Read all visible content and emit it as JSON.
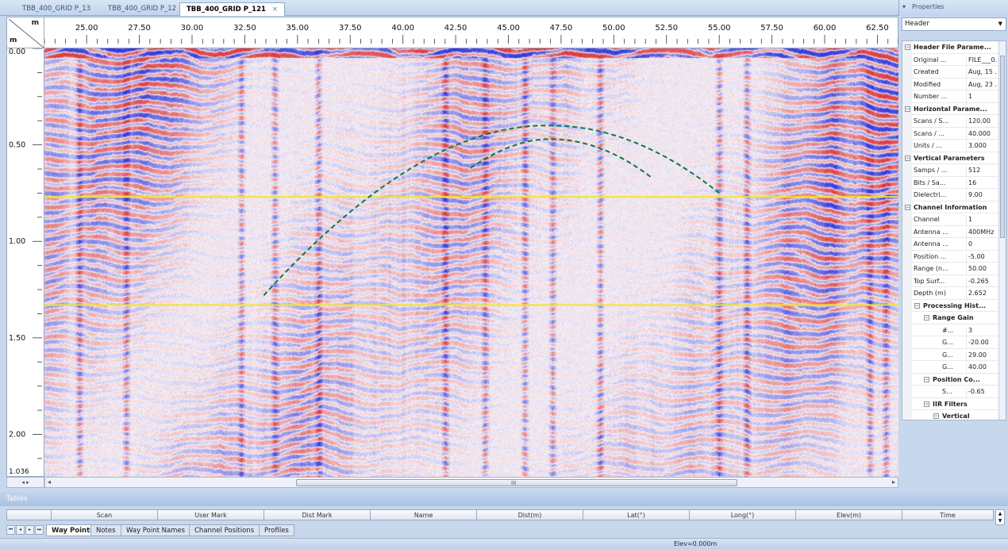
{
  "tabs": [
    {
      "label": "TBB_400_GRID P_13",
      "active": false
    },
    {
      "label": "TBB_400_GRID P_12",
      "active": false
    },
    {
      "label": "TBB_400_GRID P_121",
      "active": true
    }
  ],
  "tab_close_glyph": "×",
  "ruler": {
    "corner_top_unit": "m",
    "corner_left_unit": "m",
    "x_labels": [
      "25.00",
      "27.50",
      "30.00",
      "32.50",
      "35.00",
      "37.50",
      "40.00",
      "42.50",
      "45.00",
      "47.50",
      "50.00",
      "52.50",
      "55.00",
      "57.50",
      "60.00",
      "62.50"
    ],
    "y_labels": [
      "0.00",
      "0.50",
      "1.00",
      "1.50",
      "2.00"
    ],
    "y_bottom_label": "1.036"
  },
  "plot": {
    "colors": {
      "positive": "#e0303a",
      "negative": "#2a39d8",
      "marker_lines": "#f3e62a",
      "hyperbola": "#0c7a48"
    },
    "hyperbolas": [
      {
        "apex_x_m": 47.0,
        "apex_depth_m": 0.4,
        "left_end_x_m": 33.4,
        "left_end_depth_m": 1.28,
        "right_end_x_m": 55.0,
        "right_end_depth_m": 0.75
      },
      {
        "apex_x_m": 47.0,
        "apex_depth_m": 0.47,
        "left_end_x_m": 43.2,
        "left_end_depth_m": 0.62,
        "right_end_x_m": 51.8,
        "right_end_depth_m": 0.67
      }
    ],
    "horizontal_marker_depths_m": [
      0.77,
      1.33
    ],
    "x_range_m": [
      23.0,
      63.5
    ],
    "y_range_m": [
      0.0,
      2.22
    ]
  },
  "scroll": {
    "grip": "III"
  },
  "properties": {
    "title": "Properties",
    "selector_value": "Header",
    "rows": [
      {
        "kind": "cat",
        "indent": 0,
        "key": "Header File Parame...",
        "value": "",
        "expander": "⊟"
      },
      {
        "kind": "row",
        "indent": 0,
        "key": "Original ...",
        "value": "FILE___0..."
      },
      {
        "kind": "row",
        "indent": 0,
        "key": "Created",
        "value": "Aug, 15 ..."
      },
      {
        "kind": "row",
        "indent": 0,
        "key": "Modified",
        "value": "Aug, 23 ..."
      },
      {
        "kind": "row",
        "indent": 0,
        "key": "Number ...",
        "value": "1"
      },
      {
        "kind": "cat",
        "indent": 0,
        "key": "Horizontal Parame...",
        "value": "",
        "expander": "⊟"
      },
      {
        "kind": "row",
        "indent": 0,
        "key": "Scans / S...",
        "value": "120.00"
      },
      {
        "kind": "row",
        "indent": 0,
        "key": "Scans / ...",
        "value": "40.000"
      },
      {
        "kind": "row",
        "indent": 0,
        "key": "Units / ...",
        "value": "3.000"
      },
      {
        "kind": "cat",
        "indent": 0,
        "key": "Vertical Parameters",
        "value": "",
        "expander": "⊟"
      },
      {
        "kind": "row",
        "indent": 0,
        "key": "Samps / ...",
        "value": "512"
      },
      {
        "kind": "row",
        "indent": 0,
        "key": "Bits / Sa...",
        "value": "16"
      },
      {
        "kind": "row",
        "indent": 0,
        "key": "Dielectri...",
        "value": "9.00"
      },
      {
        "kind": "cat",
        "indent": 0,
        "key": "Channel Information",
        "value": "",
        "expander": "⊟"
      },
      {
        "kind": "row",
        "indent": 0,
        "key": "Channel",
        "value": "1"
      },
      {
        "kind": "row",
        "indent": 0,
        "key": "Antenna ...",
        "value": "400MHz"
      },
      {
        "kind": "row",
        "indent": 0,
        "key": "Antenna ...",
        "value": "0"
      },
      {
        "kind": "row",
        "indent": 0,
        "key": "Position ...",
        "value": "-5.00"
      },
      {
        "kind": "row",
        "indent": 0,
        "key": "Range (n...",
        "value": "50.00"
      },
      {
        "kind": "row",
        "indent": 0,
        "key": "Top Surf...",
        "value": "-0.265"
      },
      {
        "kind": "row",
        "indent": 0,
        "key": "Depth (m)",
        "value": "2.652"
      },
      {
        "kind": "cat",
        "indent": 1,
        "key": "Processing Hist...",
        "value": "",
        "expander": "⊟"
      },
      {
        "kind": "cat",
        "indent": 2,
        "key": "Range Gain",
        "value": "",
        "expander": "⊟"
      },
      {
        "kind": "row",
        "indent": 3,
        "key": "#...",
        "value": "3"
      },
      {
        "kind": "row",
        "indent": 3,
        "key": "G...",
        "value": "-20.00"
      },
      {
        "kind": "row",
        "indent": 3,
        "key": "G...",
        "value": "29.00"
      },
      {
        "kind": "row",
        "indent": 3,
        "key": "G...",
        "value": "40.00"
      },
      {
        "kind": "cat",
        "indent": 2,
        "key": "Position Co...",
        "value": "",
        "expander": "⊟"
      },
      {
        "kind": "row",
        "indent": 3,
        "key": "S...",
        "value": "-0.65"
      },
      {
        "kind": "cat",
        "indent": 2,
        "key": "IIR Filters",
        "value": "",
        "expander": "⊟"
      },
      {
        "kind": "cat",
        "indent": 3,
        "key": "Vertical",
        "value": "",
        "expander": "⊟"
      }
    ]
  },
  "tables": {
    "title": "Tables",
    "columns": [
      "Scan",
      "User Mark",
      "Dist Mark",
      "Name",
      "Dist(m)",
      "Lat(°)",
      "Long(°)",
      "Elev(m)",
      "Time"
    ],
    "tabs": [
      "Way Points",
      "Notes",
      "Way Point Names",
      "Channel Positions",
      "Profiles"
    ],
    "active_tab": "Way Points"
  },
  "status": {
    "elevation": "Elev=0.000m"
  }
}
